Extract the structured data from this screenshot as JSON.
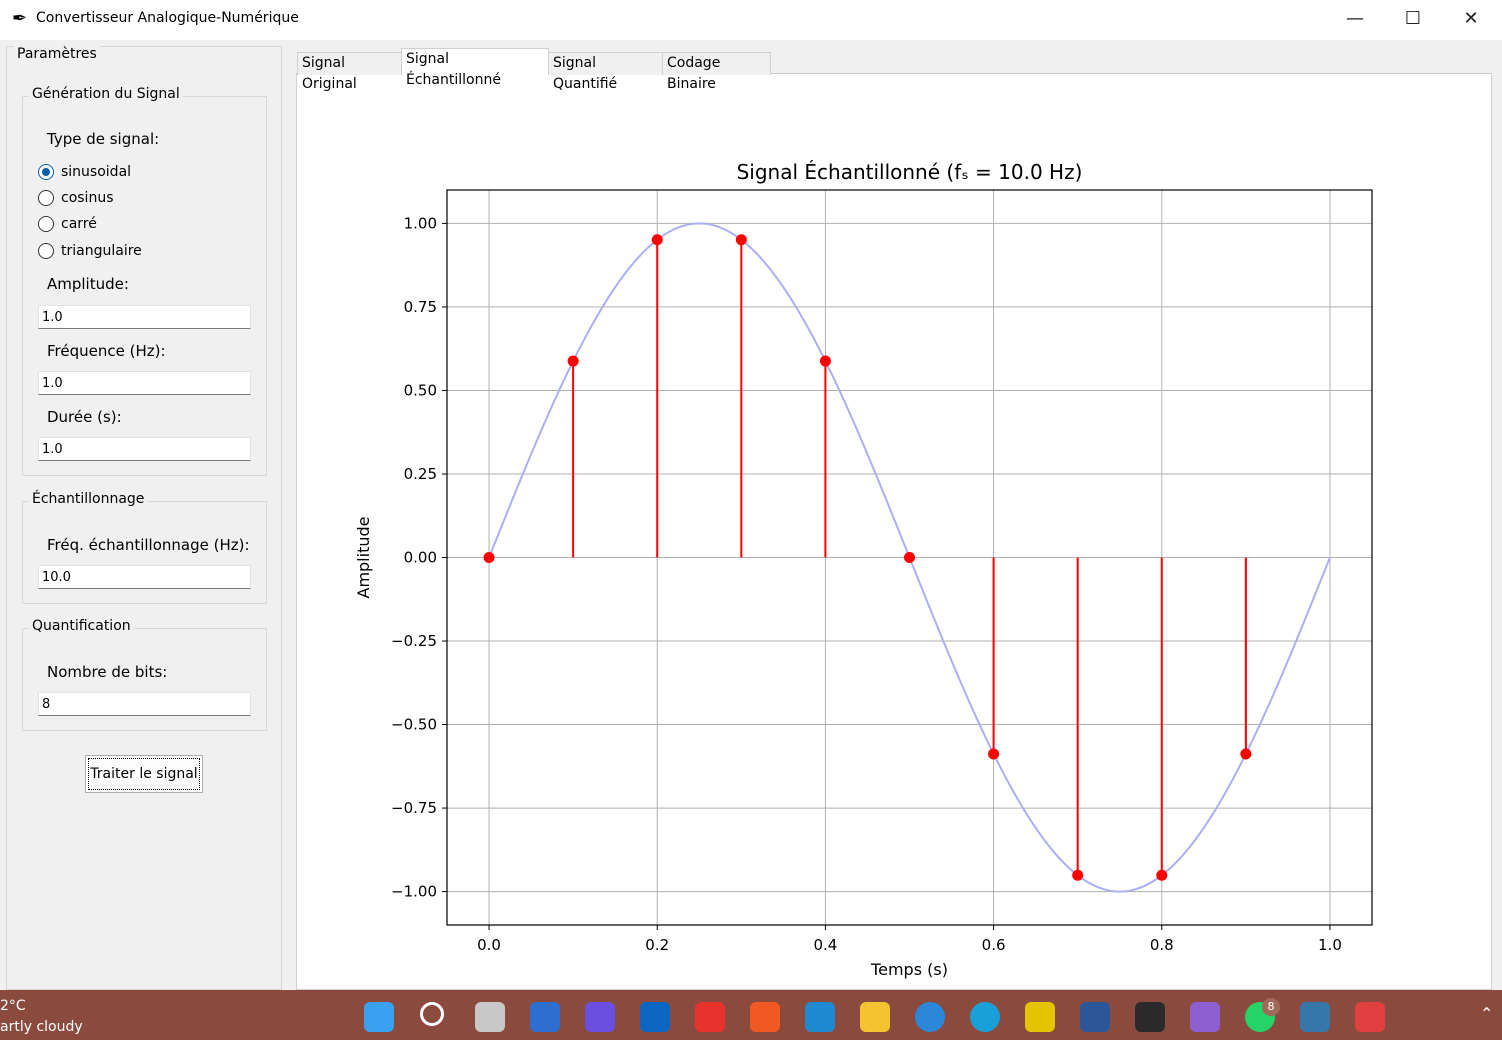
{
  "window": {
    "title": "Convertisseur Analogique-Numérique",
    "controls": {
      "minimize": "—",
      "maximize": "☐",
      "close": "✕"
    }
  },
  "sidebar": {
    "title": "Paramètres",
    "generation": {
      "title": "Génération du Signal",
      "type_label": "Type de signal:",
      "options": [
        "sinusoidal",
        "cosinus",
        "carré",
        "triangulaire"
      ],
      "selected": "sinusoidal",
      "amplitude_label": "Amplitude:",
      "amplitude_value": "1.0",
      "freq_label": "Fréquence (Hz):",
      "freq_value": "1.0",
      "duration_label": "Durée (s):",
      "duration_value": "1.0"
    },
    "sampling": {
      "title": "Échantillonnage",
      "fs_label": "Fréq. échantillonnage (Hz):",
      "fs_value": "10.0"
    },
    "quantization": {
      "title": "Quantification",
      "bits_label": "Nombre de bits:",
      "bits_value": "8"
    },
    "process_button": "Traiter le signal"
  },
  "tabs": [
    "Signal Original",
    "Signal Échantillonné",
    "Signal Quantifié",
    "Codage Binaire"
  ],
  "active_tab": 1,
  "chart_data": {
    "type": "line",
    "title": "Signal Échantillonné (fₛ = 10.0 Hz)",
    "xlabel": "Temps (s)",
    "ylabel": "Amplitude",
    "xlim": [
      -0.05,
      1.05
    ],
    "ylim": [
      -1.1,
      1.1
    ],
    "xticks": [
      0.0,
      0.2,
      0.4,
      0.6,
      0.8,
      1.0
    ],
    "xtick_labels": [
      "0.0",
      "0.2",
      "0.4",
      "0.6",
      "0.8",
      "1.0"
    ],
    "yticks": [
      1.0,
      0.75,
      0.5,
      0.25,
      0.0,
      -0.25,
      -0.5,
      -0.75,
      -1.0
    ],
    "ytick_labels": [
      "1.00",
      "0.75",
      "0.50",
      "0.25",
      "0.00",
      "−0.25",
      "−0.50",
      "−0.75",
      "−1.00"
    ],
    "grid": true,
    "series": [
      {
        "kind": "continuous",
        "function": "sin(2π·1.0·t)",
        "t_range": [
          0,
          1
        ],
        "color": "#aab0f0"
      },
      {
        "kind": "stem",
        "color": "#ff0000",
        "x": [
          0.0,
          0.1,
          0.2,
          0.3,
          0.4,
          0.5,
          0.6,
          0.7,
          0.8,
          0.9
        ],
        "values": [
          0.0,
          0.588,
          0.951,
          0.951,
          0.588,
          0.0,
          -0.588,
          -0.951,
          -0.951,
          -0.588
        ]
      }
    ]
  },
  "taskbar": {
    "weather_temp": "2°C",
    "weather_text": "artly cloudy",
    "whatsapp_badge": "8"
  }
}
